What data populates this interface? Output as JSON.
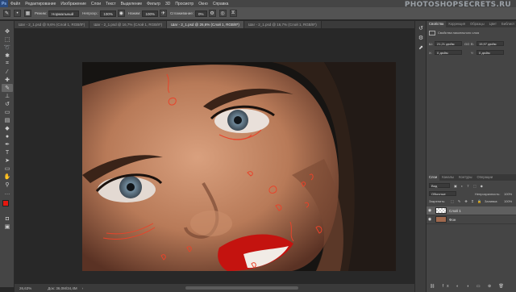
{
  "app": {
    "logo": "Ps"
  },
  "watermark": "PHOTOSHOPSECRETS.RU",
  "menu": [
    "Файл",
    "Редактирование",
    "Изображение",
    "Слои",
    "Текст",
    "Выделение",
    "Фильтр",
    "3D",
    "Просмотр",
    "Окно",
    "Справка"
  ],
  "options": {
    "mode_label": "Режим:",
    "mode_value": "Нормальный",
    "opacity_label": "Непрозр.:",
    "opacity_value": "100%",
    "pressure_label": "Нажим:",
    "pressure_value": "100%",
    "smooth_label": "Сглаживание:",
    "smooth_value": "0%"
  },
  "tabs": [
    {
      "label": "Шаг - 2_1.psd @ 9,6% (Слой 1, RGB/8*)",
      "active": false
    },
    {
      "label": "Шаг - 2_1.psd @ 16,7% (Слой 1, RGB/8*)",
      "active": false
    },
    {
      "label": "Шаг - 2_1.psd @ 26,6% (Слой 1, RGB/8*)",
      "active": true
    },
    {
      "label": "Шаг - 2_1.psd @ 16,7% (Слой 1, RGB/8*)",
      "active": false
    }
  ],
  "status": {
    "zoom": "26,63%",
    "doc": "Док: 36,0M/34,4M"
  },
  "properties": {
    "tabs": [
      "Свойства",
      "Коррекция",
      "Образцы",
      "Цвет",
      "Библиот"
    ],
    "title": "Свойства пиксельного слоя",
    "w": "21,21 дюйм",
    "h": "15,97 дюйм",
    "x": "0 дюйм",
    "y": "0 дюйм",
    "w_label": "Ш:",
    "h_label": "В:",
    "x_label": "X:",
    "y_label": "Y:",
    "link": "GO"
  },
  "layers_panel": {
    "tabs": [
      "Слои",
      "Каналы",
      "Контуры",
      "Операции"
    ],
    "filter_placeholder": "Вид",
    "blend": "Обычные",
    "opacity_label": "Непрозрачность:",
    "opacity_value": "100%",
    "lock_label": "Закрепить:",
    "fill_label": "Заливка:",
    "fill_value": "100%",
    "layers": [
      {
        "name": "Слой 1",
        "selected": true
      },
      {
        "name": "Фон",
        "selected": false
      }
    ]
  },
  "colors": {
    "foreground": "#e5170f",
    "background": "#ffffff",
    "sketch": "#e8432a"
  }
}
